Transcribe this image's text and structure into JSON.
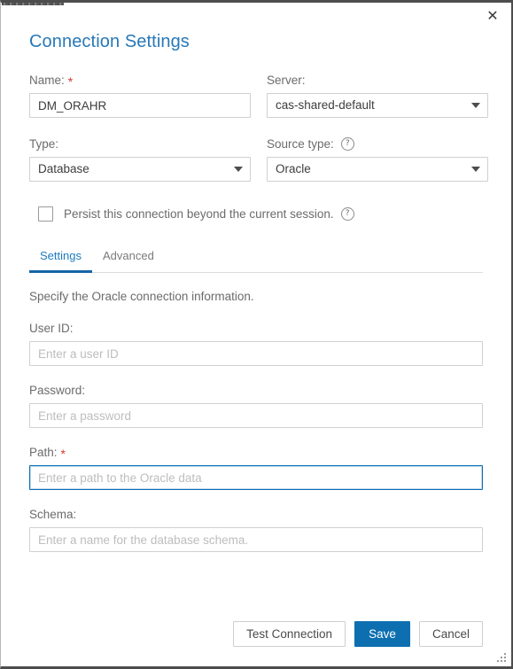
{
  "window": {
    "close_label": "✕",
    "title": "Connection Settings"
  },
  "form": {
    "name": {
      "label": "Name:",
      "required_marker": "*",
      "value": "DM_ORAHR",
      "placeholder": ""
    },
    "server": {
      "label": "Server:",
      "value": "cas-shared-default"
    },
    "type": {
      "label": "Type:",
      "value": "Database"
    },
    "source_type": {
      "label": "Source type:",
      "help_glyph": "?",
      "value": "Oracle"
    },
    "persist": {
      "label": "Persist this connection beyond the current session.",
      "checked": false,
      "help_glyph": "?"
    }
  },
  "tabs": [
    {
      "label": "Settings",
      "active": true
    },
    {
      "label": "Advanced",
      "active": false
    }
  ],
  "settings_panel": {
    "description": "Specify the Oracle connection information.",
    "fields": {
      "user_id": {
        "label": "User ID:",
        "placeholder": "Enter a user ID",
        "value": ""
      },
      "password": {
        "label": "Password:",
        "placeholder": "Enter a password",
        "value": ""
      },
      "path": {
        "label": "Path:",
        "required_marker": "*",
        "placeholder": "Enter a path to the Oracle data",
        "value": "",
        "focused": true
      },
      "schema": {
        "label": "Schema:",
        "placeholder": "Enter a name for the database schema.",
        "value": ""
      }
    }
  },
  "footer": {
    "test_connection_label": "Test Connection",
    "save_label": "Save",
    "cancel_label": "Cancel"
  },
  "colors": {
    "title_blue": "#2878b8",
    "accent_blue": "#0d6fb0",
    "tab_active_underline": "#1565a8",
    "required_red": "#d13a2e",
    "focus_border": "#0b6eb5"
  }
}
